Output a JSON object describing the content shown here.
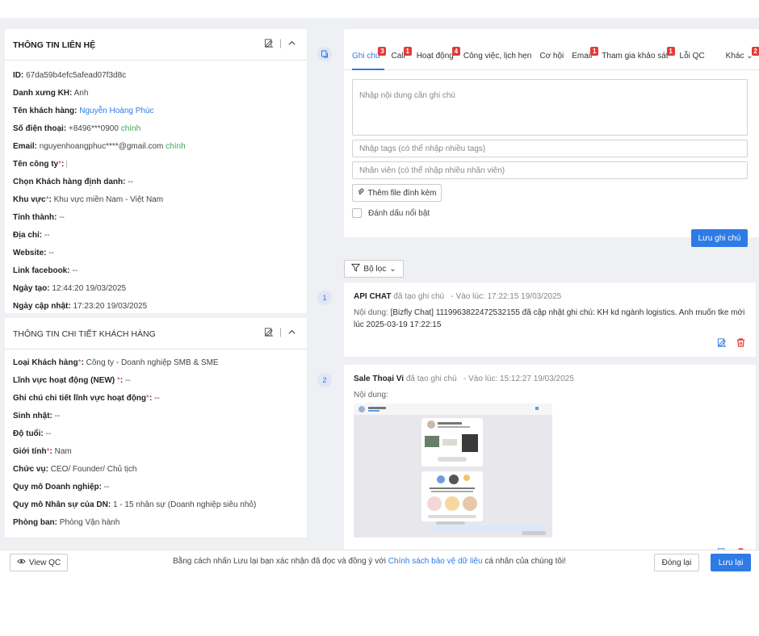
{
  "contact": {
    "title": "THÔNG TIN LIÊN HỆ",
    "id_label": "ID:",
    "id_value": "67da59b4efc5afead07f3d8c",
    "salutation_label": "Danh xưng KH:",
    "salutation_value": "Anh",
    "name_label": "Tên khách hàng:",
    "name_value": "Nguyễn Hoàng Phúc",
    "phone_label": "Số điện thoại:",
    "phone_value": "+8496***0900",
    "phone_tag": "chính",
    "email_label": "Email:",
    "email_value": "nguyenhoangphuc****@gmail.com",
    "email_tag": "chính",
    "company_label": "Tên công ty",
    "company_value": "",
    "identified_label": "Chọn Khách hàng định danh:",
    "identified_value": "--",
    "region_label": "Khu vực",
    "region_value": "Khu vực miền Nam - Việt Nam",
    "province_label": "Tỉnh thành:",
    "province_value": "--",
    "address_label": "Địa chỉ:",
    "address_value": "--",
    "website_label": "Website:",
    "website_value": "--",
    "facebook_label": "Link facebook:",
    "facebook_value": "--",
    "created_label": "Ngày tạo:",
    "created_value": "12:44:20 19/03/2025",
    "updated_label": "Ngày cập nhật:",
    "updated_value": "17:23:20 19/03/2025"
  },
  "details": {
    "title": "THÔNG TIN CHI TIẾT KHÁCH HÀNG",
    "type_label": "Loại Khách hàng",
    "type_value": "Công ty - Doanh nghiệp SMB & SME",
    "field_label": "Lĩnh vực hoạt động (NEW)",
    "field_value": "--",
    "field_note_label": "Ghi chú chi tiết lĩnh vực hoạt động",
    "field_note_value": "--",
    "birthday_label": "Sinh nhật:",
    "birthday_value": "--",
    "age_label": "Độ tuổi:",
    "age_value": "--",
    "gender_label": "Giới tính",
    "gender_value": "Nam",
    "position_label": "Chức vụ:",
    "position_value": "CEO/ Founder/ Chủ tịch",
    "scale_label": "Quy mô Doanh nghiệp:",
    "scale_value": "--",
    "staff_label": "Quy mô Nhân sự của DN:",
    "staff_value": "1 - 15 nhân sự (Doanh nghiệp siêu nhỏ)",
    "dept_label": "Phòng ban:",
    "dept_value": "Phòng Vận hành"
  },
  "tabs": [
    {
      "label": "Ghi chú",
      "badge": "3"
    },
    {
      "label": "Call",
      "badge": "1"
    },
    {
      "label": "Hoạt động",
      "badge": "4"
    },
    {
      "label": "Công việc, lịch hẹn",
      "badge": ""
    },
    {
      "label": "Cơ hội",
      "badge": ""
    },
    {
      "label": "Email",
      "badge": "1"
    },
    {
      "label": "Tham gia khảo sát",
      "badge": "1"
    },
    {
      "label": "Lỗi QC",
      "badge": ""
    },
    {
      "label": "Khác",
      "badge": "2"
    }
  ],
  "note_form": {
    "content_placeholder": "Nhập nội dung cần ghi chú",
    "tags_placeholder": "Nhập tags (có thể nhập nhiều tags)",
    "staff_placeholder": "Nhân viên (có thể nhập nhiều nhân viên)",
    "attach_label": "Thêm file đính kèm",
    "highlight_label": "Đánh dấu nổi bật",
    "save_label": "Lưu ghi chú"
  },
  "filter_label": "Bộ lọc",
  "notes": [
    {
      "index": "1",
      "author": "API CHAT",
      "action": "đã tạo ghi chú",
      "time": "- Vào lúc: 17:22:15 19/03/2025",
      "body_label": "Nội dung:",
      "body": "[Bizfly Chat] 1119963822472532155 đã cập nhật ghi chú: KH kd ngành logistics. Anh muốn tke mới lúc 2025-03-19 17:22:15"
    },
    {
      "index": "2",
      "author": "Sale Thoại Vi",
      "action": "đã tạo ghi chú",
      "time": "- Vào lúc: 15:12:27 19/03/2025",
      "body_label": "Nội dung:",
      "body": ""
    }
  ],
  "footer": {
    "view_qc": "View QC",
    "text_before": "Bằng cách nhấn Lưu lại bạn xác nhận đã đọc và đồng ý với",
    "link": "Chính sách bảo vệ dữ liệu",
    "text_after": "cá nhân của chúng tôi!",
    "close_label": "Đóng lại",
    "save_label": "Lưu lại"
  },
  "colors": {
    "accent": "#2f7be5",
    "danger": "#e53935",
    "background": "#eef0f3"
  }
}
